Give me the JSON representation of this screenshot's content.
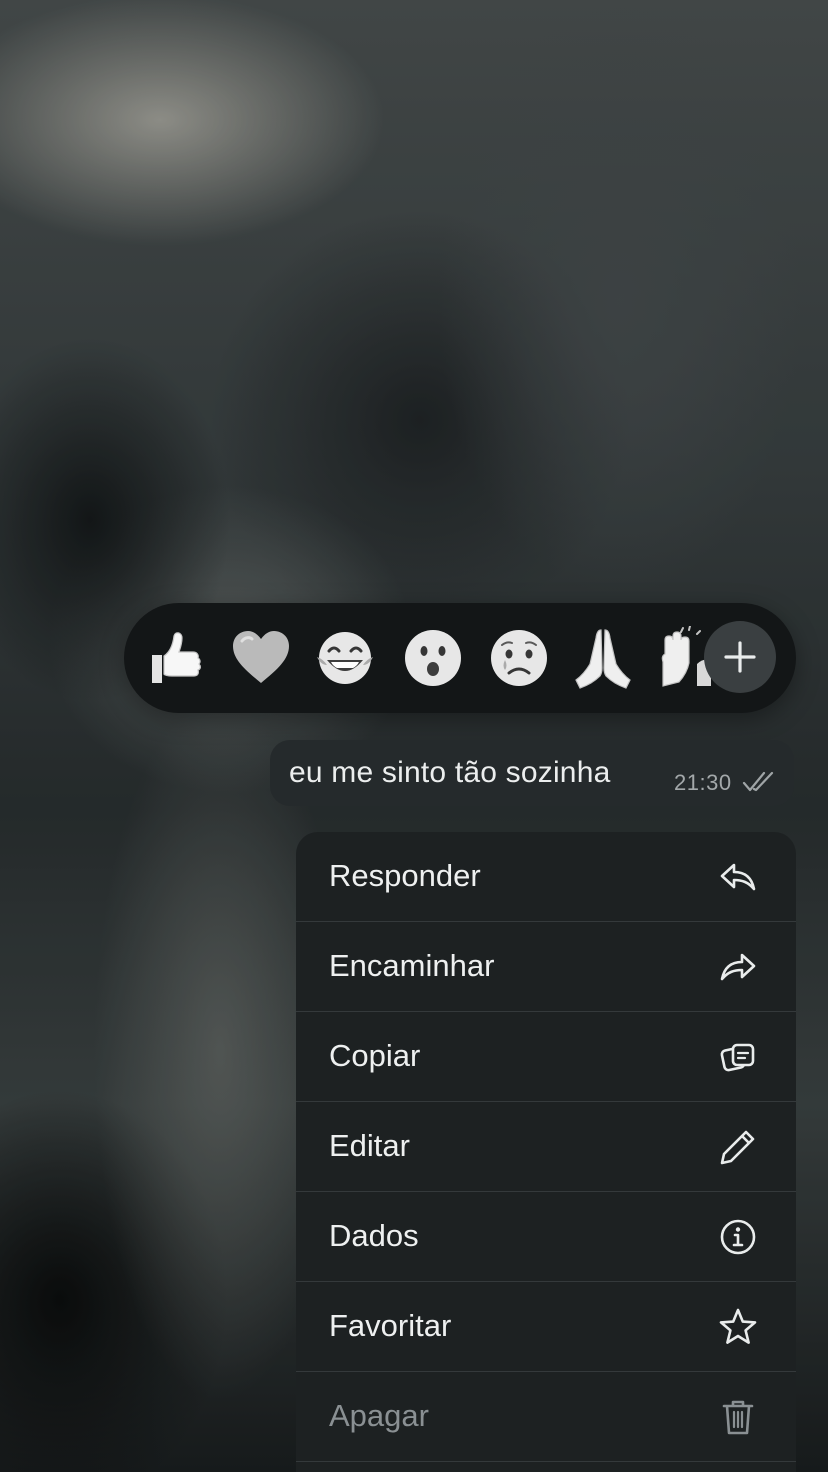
{
  "reactions": {
    "items": [
      "thumbs-up",
      "white-heart",
      "tears-of-joy",
      "surprised-face",
      "crying-face",
      "folded-hands",
      "raising-hands"
    ],
    "add_label": "+"
  },
  "message": {
    "text": "eu me sinto tão sozinha",
    "time": "21:30",
    "status": "read"
  },
  "menu": {
    "items": [
      {
        "label": "Responder",
        "icon": "reply-icon"
      },
      {
        "label": "Encaminhar",
        "icon": "forward-icon"
      },
      {
        "label": "Copiar",
        "icon": "copy-icon"
      },
      {
        "label": "Editar",
        "icon": "pencil-icon"
      },
      {
        "label": "Dados",
        "icon": "info-icon"
      },
      {
        "label": "Favoritar",
        "icon": "star-icon"
      },
      {
        "label": "Apagar",
        "icon": "trash-icon"
      }
    ]
  }
}
